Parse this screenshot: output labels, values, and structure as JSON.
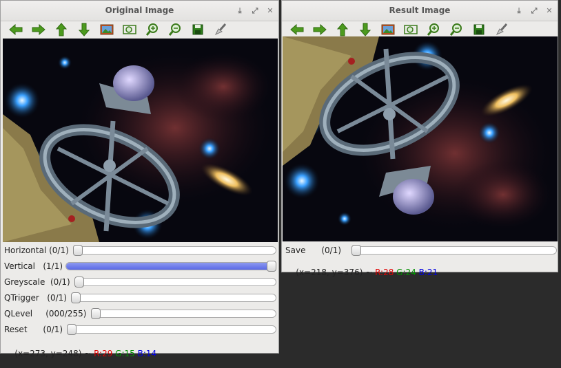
{
  "windows": {
    "original": {
      "title": "Original Image",
      "status": {
        "coords": "(x=273, y=248) ~ ",
        "r": "R:29",
        "g": "G:15",
        "b": "B:14"
      },
      "trackbars": [
        {
          "label": "Horizontal (0/1)",
          "value": 0,
          "max": 1
        },
        {
          "label": "Vertical   (1/1)",
          "value": 1,
          "max": 1
        },
        {
          "label": "Greyscale  (0/1)",
          "value": 0,
          "max": 1
        },
        {
          "label": "QTrigger   (0/1)",
          "value": 0,
          "max": 1
        },
        {
          "label": "QLevel     (000/255)",
          "value": 0,
          "max": 255
        },
        {
          "label": "Reset      (0/1)",
          "value": 0,
          "max": 1
        }
      ]
    },
    "result": {
      "title": "Result Image",
      "status": {
        "coords": "(x=218, y=376) ~ ",
        "r": "R:28",
        "g": "G:24",
        "b": "B:21"
      },
      "trackbars": [
        {
          "label": "Save      (0/1)",
          "value": 0,
          "max": 1
        }
      ]
    }
  },
  "toolbar_icons": [
    "arrow-left-icon",
    "arrow-right-icon",
    "arrow-up-icon",
    "arrow-down-icon",
    "image-icon",
    "zoom-fit-icon",
    "zoom-in-icon",
    "zoom-out-icon",
    "save-icon",
    "properties-icon"
  ],
  "colors": {
    "accent_fill": "#6673e8",
    "arrow_green": "#4c9a1e",
    "status_red": "#e00000",
    "status_green": "#008f00",
    "status_blue": "#0000e0"
  }
}
